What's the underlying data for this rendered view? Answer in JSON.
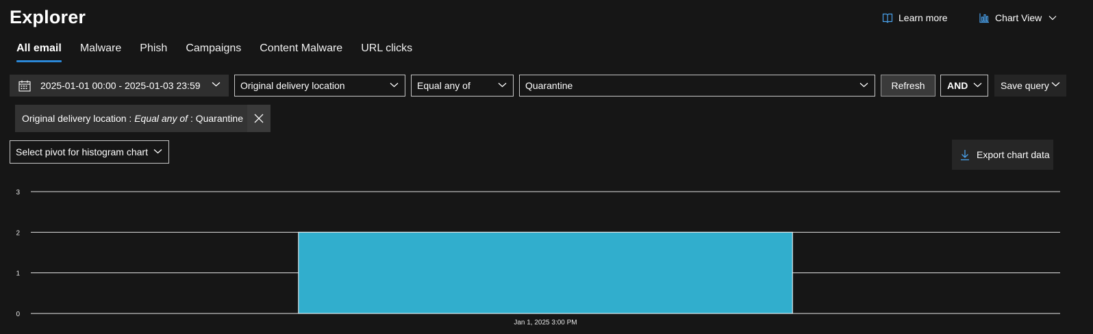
{
  "header": {
    "title": "Explorer",
    "learn_more": "Learn more",
    "chart_view": "Chart View"
  },
  "tabs": [
    {
      "label": "All email",
      "active": true
    },
    {
      "label": "Malware",
      "active": false
    },
    {
      "label": "Phish",
      "active": false
    },
    {
      "label": "Campaigns",
      "active": false
    },
    {
      "label": "Content Malware",
      "active": false
    },
    {
      "label": "URL clicks",
      "active": false
    }
  ],
  "filters": {
    "date_range": "2025-01-01 00:00 - 2025-01-03 23:59",
    "field": "Original delivery location",
    "operator": "Equal any of",
    "value": "Quarantine",
    "refresh_label": "Refresh",
    "logic": "AND",
    "save_query": "Save query"
  },
  "active_filter": {
    "field": "Original delivery location",
    "sep1": ":",
    "operator": "Equal any of",
    "sep2": ":",
    "value": "Quarantine"
  },
  "pivot": {
    "label": "Select pivot for histogram chart"
  },
  "export": {
    "label": "Export chart data"
  },
  "icons": {
    "learn_more": "book-icon",
    "chart_view": "bar-chart-icon",
    "date": "calendar-icon",
    "export": "download-icon",
    "remove_filter": "close-icon"
  },
  "colors": {
    "background": "#161616",
    "accent": "#2b88d8",
    "bar": "#31aecd"
  },
  "chart_data": {
    "type": "bar",
    "categories": [
      "Jan 1, 2025 3:00 PM"
    ],
    "values": [
      2
    ],
    "ylim": [
      0,
      3
    ],
    "yticks": [
      0,
      1,
      2,
      3
    ],
    "grid": true
  }
}
